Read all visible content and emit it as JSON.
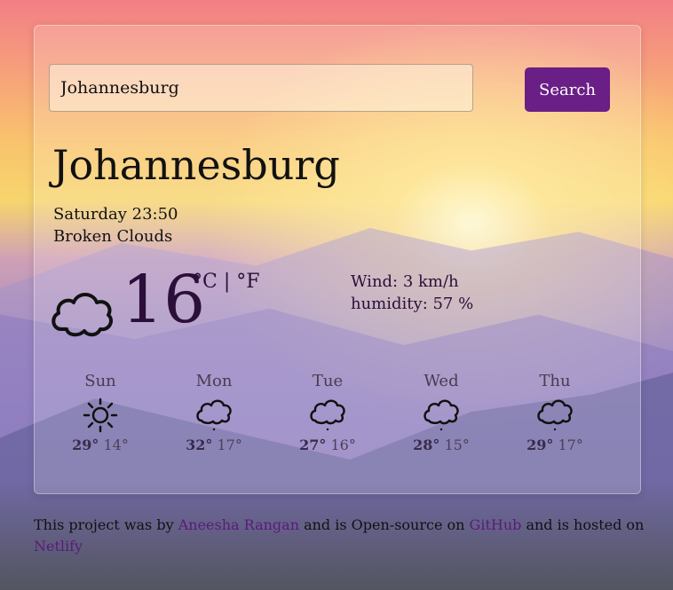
{
  "search": {
    "value": "Johannesburg",
    "button_label": "Search"
  },
  "current": {
    "city": "Johannesburg",
    "datetime": "Saturday 23:50",
    "description": "Broken Clouds",
    "icon": "cloud-icon",
    "temperature": "16",
    "unit_celsius": "°C",
    "unit_separator": " | ",
    "unit_fahrenheit": "°F",
    "wind": "Wind: 3 km/h",
    "humidity": "humidity: 57 %"
  },
  "forecast": [
    {
      "day": "Sun",
      "icon": "sun-icon",
      "max": "29°",
      "min": "14°"
    },
    {
      "day": "Mon",
      "icon": "cloud-icon",
      "max": "32°",
      "min": "17°"
    },
    {
      "day": "Tue",
      "icon": "cloud-icon",
      "max": "27°",
      "min": "16°"
    },
    {
      "day": "Wed",
      "icon": "cloud-icon",
      "max": "28°",
      "min": "15°"
    },
    {
      "day": "Thu",
      "icon": "cloud-icon",
      "max": "29°",
      "min": "17°"
    }
  ],
  "footer": {
    "text1": "This project was by ",
    "author": "Aneesha Rangan",
    "text2": " and is Open-source on ",
    "github": "GitHub",
    "text3": " and is hosted on ",
    "netlify": "Netlify"
  },
  "colors": {
    "button_bg": "#6a1f86",
    "link": "#5a1a7a",
    "temperature": "#2b0f3a"
  }
}
